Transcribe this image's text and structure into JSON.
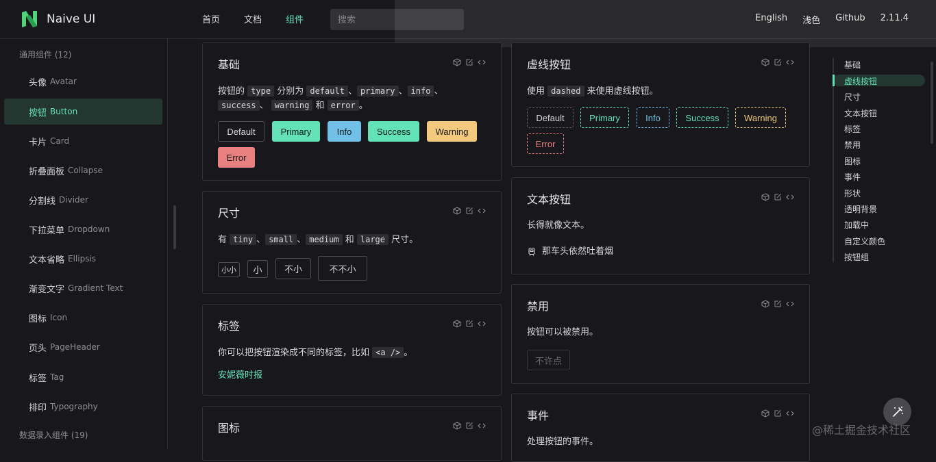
{
  "header": {
    "logo_text": "Naive UI",
    "nav": [
      "首页",
      "文档",
      "组件"
    ],
    "search_placeholder": "搜索",
    "right": [
      "English",
      "浅色",
      "Github",
      "2.11.4"
    ]
  },
  "sidebar": {
    "group1": "通用组件 (12)",
    "items": [
      {
        "zh": "头像",
        "en": "Avatar"
      },
      {
        "zh": "按钮",
        "en": "Button"
      },
      {
        "zh": "卡片",
        "en": "Card"
      },
      {
        "zh": "折叠面板",
        "en": "Collapse"
      },
      {
        "zh": "分割线",
        "en": "Divider"
      },
      {
        "zh": "下拉菜单",
        "en": "Dropdown"
      },
      {
        "zh": "文本省略",
        "en": "Ellipsis"
      },
      {
        "zh": "渐变文字",
        "en": "Gradient Text"
      },
      {
        "zh": "图标",
        "en": "Icon"
      },
      {
        "zh": "页头",
        "en": "PageHeader"
      },
      {
        "zh": "标签",
        "en": "Tag"
      },
      {
        "zh": "排印",
        "en": "Typography"
      }
    ],
    "group2": "数据录入组件 (19)"
  },
  "cards": {
    "basic": {
      "title": "基础",
      "d1": "按钮的",
      "c1": "type",
      "d2": "分别为",
      "c2": "default",
      "s1": "、",
      "c3": "primary",
      "s2": "、",
      "c4": "info",
      "s3": "、",
      "c5": "success",
      "s4": "、",
      "c6": "warning",
      "d3": "和",
      "c7": "error",
      "d4": "。",
      "buttons": [
        "Default",
        "Primary",
        "Info",
        "Success",
        "Warning",
        "Error"
      ]
    },
    "size": {
      "title": "尺寸",
      "d1": "有",
      "c1": "tiny",
      "s1": "、",
      "c2": "small",
      "s2": "、",
      "c3": "medium",
      "d2": "和",
      "c4": "large",
      "d3": "尺寸。",
      "buttons": [
        "小小",
        "小",
        "不小",
        "不不小"
      ]
    },
    "tag": {
      "title": "标签",
      "d1": "你可以把按钮渲染成不同的标签，比如",
      "c1": "<a />",
      "d2": "。",
      "link": "安妮薇时报"
    },
    "icon": {
      "title": "图标"
    },
    "dashed": {
      "title": "虚线按钮",
      "d1": "使用",
      "c1": "dashed",
      "d2": "来使用虚线按钮。",
      "buttons": [
        "Default",
        "Primary",
        "Info",
        "Success",
        "Warning",
        "Error"
      ]
    },
    "text": {
      "title": "文本按钮",
      "desc": "长得就像文本。",
      "button": "那车头依然吐着烟"
    },
    "disabled": {
      "title": "禁用",
      "desc": "按钮可以被禁用。",
      "button": "不许点"
    },
    "event": {
      "title": "事件",
      "desc": "处理按钮的事件。"
    }
  },
  "toc": [
    "基础",
    "虚线按钮",
    "尺寸",
    "文本按钮",
    "标签",
    "禁用",
    "图标",
    "事件",
    "形状",
    "透明背景",
    "加载中",
    "自定义颜色",
    "按钮组"
  ],
  "watermark": "@稀土掘金技术社区",
  "colors": {
    "accent": "#63e2b7",
    "info": "#70c0e8",
    "warning": "#f2c97d",
    "error": "#e88080",
    "background": "#18181c"
  }
}
